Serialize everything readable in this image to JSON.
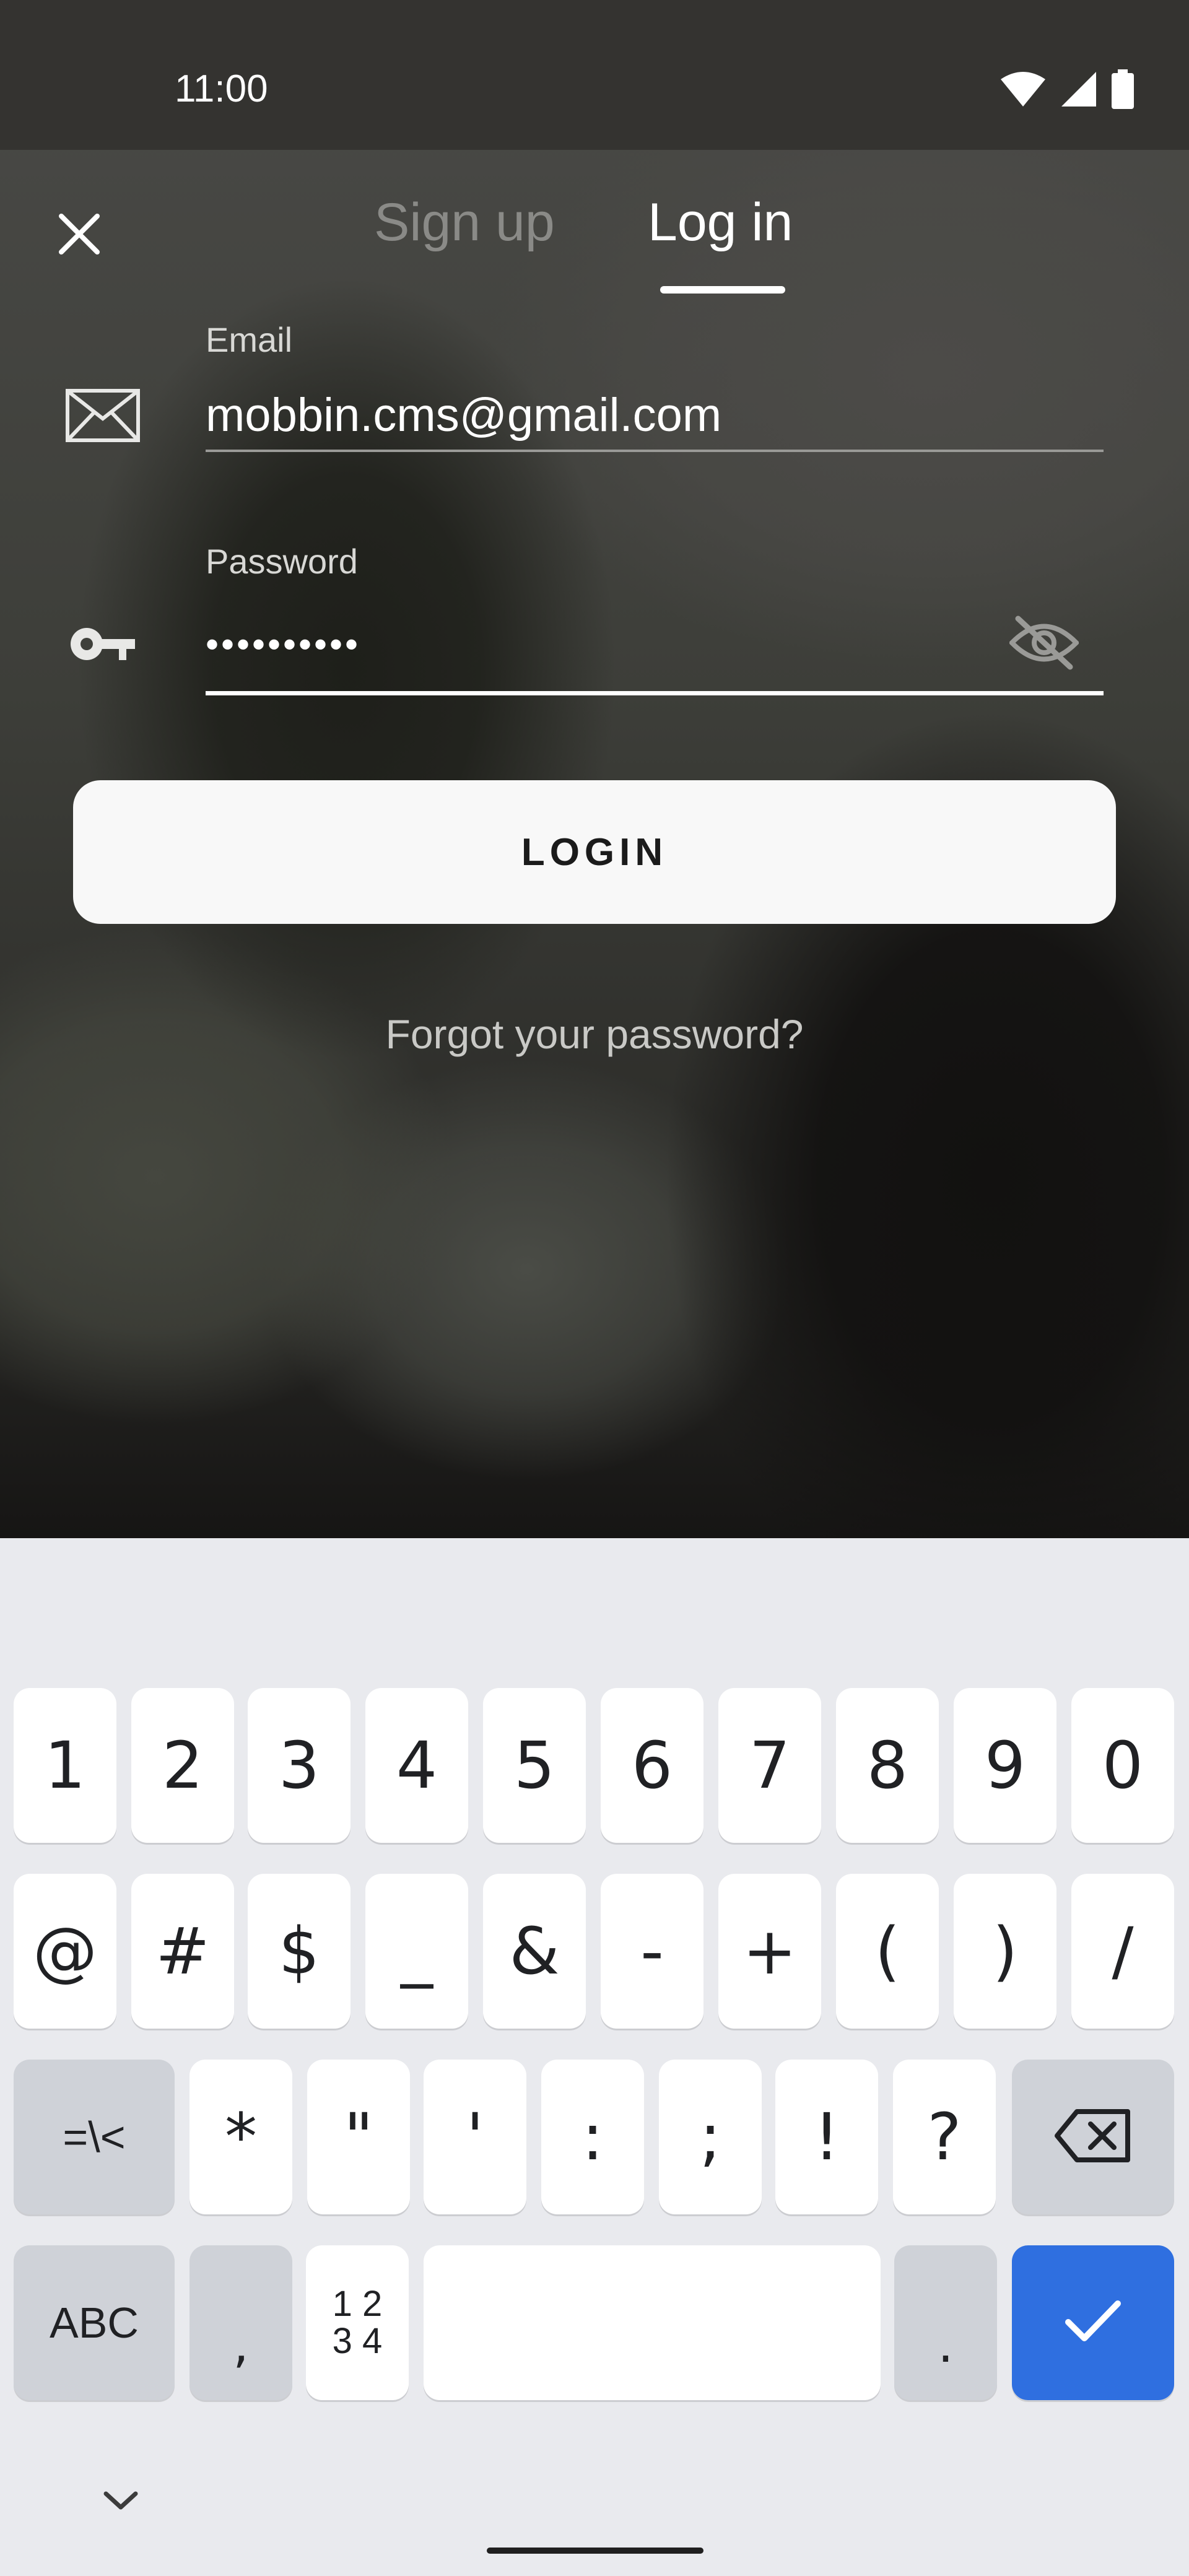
{
  "status_bar": {
    "time": "11:00"
  },
  "tabs": [
    {
      "label": "Sign up",
      "active": false
    },
    {
      "label": "Log in",
      "active": true
    }
  ],
  "form": {
    "email_label": "Email",
    "email_value": "mobbin.cms@gmail.com",
    "password_label": "Password",
    "password_value": "••••••••••",
    "login_label": "LOGIN",
    "forgot_label": "Forgot your password?"
  },
  "keyboard": {
    "row1": [
      "1",
      "2",
      "3",
      "4",
      "5",
      "6",
      "7",
      "8",
      "9",
      "0"
    ],
    "row2": [
      "@",
      "#",
      "$",
      "_",
      "&",
      "-",
      "+",
      "(",
      ")",
      "/"
    ],
    "row3": [
      "=\\<",
      "*",
      "\"",
      "'",
      ":",
      ";",
      "!",
      "?"
    ],
    "row4": [
      "ABC",
      ",",
      "1 2\n3 4",
      "",
      " ."
    ],
    "abc_label": "ABC",
    "symbols_label": "=\\<",
    "numpad_label_top": "1 2",
    "numpad_label_bottom": "3 4",
    "comma": ",",
    "period": "."
  },
  "colors": {
    "accent": "#2f6fe0",
    "key_light": "#ffffff",
    "key_dark": "#cfd2d8",
    "keyboard_bg": "#e9eaee"
  }
}
